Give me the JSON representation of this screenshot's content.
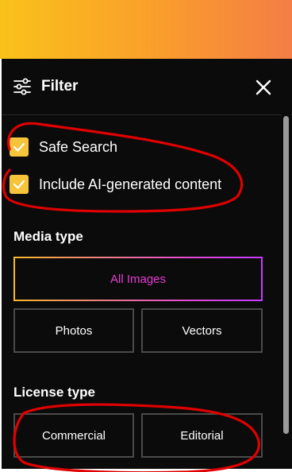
{
  "header": {
    "title": "Filter"
  },
  "checks": {
    "safe_search": {
      "label": "Safe Search",
      "checked": true
    },
    "ai_content": {
      "label": "Include AI-generated content",
      "checked": true
    }
  },
  "media_type": {
    "title": "Media type",
    "options": [
      "All Images",
      "Photos",
      "Vectors"
    ],
    "selected": "All Images"
  },
  "license_type": {
    "title": "License type",
    "options": [
      "Commercial",
      "Editorial"
    ]
  },
  "colors": {
    "accent": "#f5c43a",
    "selected_text": "#e63bd1",
    "annotation": "#e00000",
    "panel_bg": "#0b0b0b"
  }
}
